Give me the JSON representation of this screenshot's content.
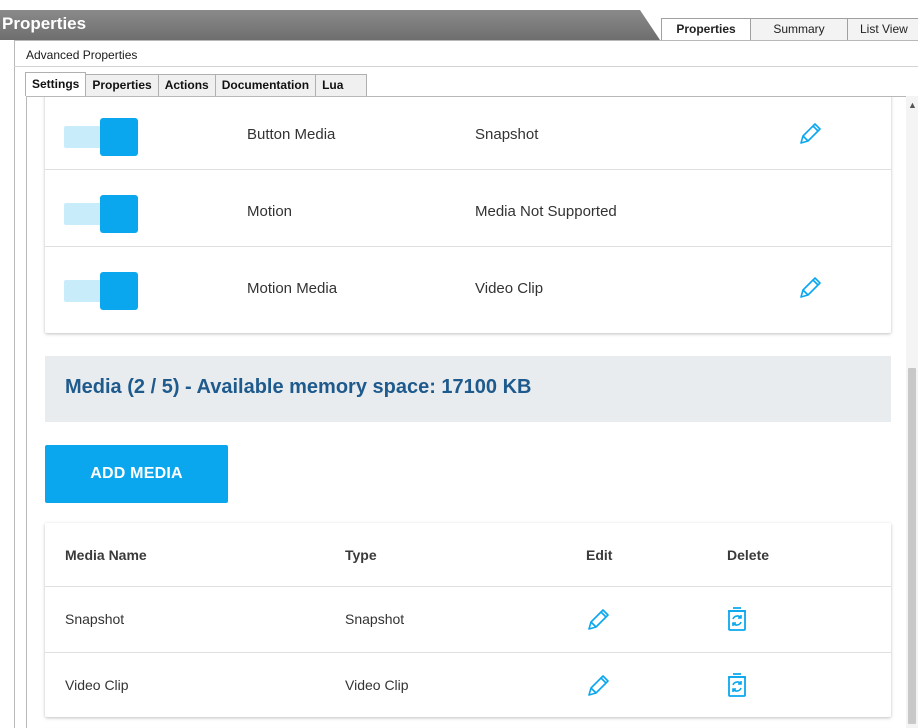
{
  "window": {
    "title": "Properties",
    "tabs": [
      {
        "label": "Properties",
        "active": true
      },
      {
        "label": "Summary",
        "active": false
      },
      {
        "label": "List View",
        "active": false
      }
    ]
  },
  "advanced_label": "Advanced Properties",
  "subtabs": [
    {
      "label": "Settings",
      "active": true
    },
    {
      "label": "Properties",
      "active": false
    },
    {
      "label": "Actions",
      "active": false
    },
    {
      "label": "Documentation",
      "active": false
    },
    {
      "label": "Lua",
      "active": false
    }
  ],
  "toggle_rows": [
    {
      "name": "Button Media",
      "value": "Snapshot",
      "enabled": true,
      "editable": true,
      "icon": "pencil-icon"
    },
    {
      "name": "Motion",
      "value": "Media Not Supported",
      "enabled": true,
      "editable": false
    },
    {
      "name": "Motion Media",
      "value": "Video Clip",
      "enabled": true,
      "editable": true,
      "icon": "pencil-icon"
    }
  ],
  "media_banner": "Media (2 / 5) - Available memory space: 17100 KB",
  "add_media_label": "ADD MEDIA",
  "media_table": {
    "headers": [
      "Media Name",
      "Type",
      "Edit",
      "Delete"
    ],
    "rows": [
      {
        "name": "Snapshot",
        "type": "Snapshot",
        "edit_icon": "pencil-icon",
        "delete_icon": "trash-refresh-icon"
      },
      {
        "name": "Video Clip",
        "type": "Video Clip",
        "edit_icon": "pencil-icon",
        "delete_icon": "trash-refresh-icon"
      }
    ]
  },
  "colors": {
    "accent": "#0aa7ee",
    "accent_light": "#c9ecfb",
    "banner_bg": "#e9ecef",
    "banner_text": "#1e5a8c"
  }
}
